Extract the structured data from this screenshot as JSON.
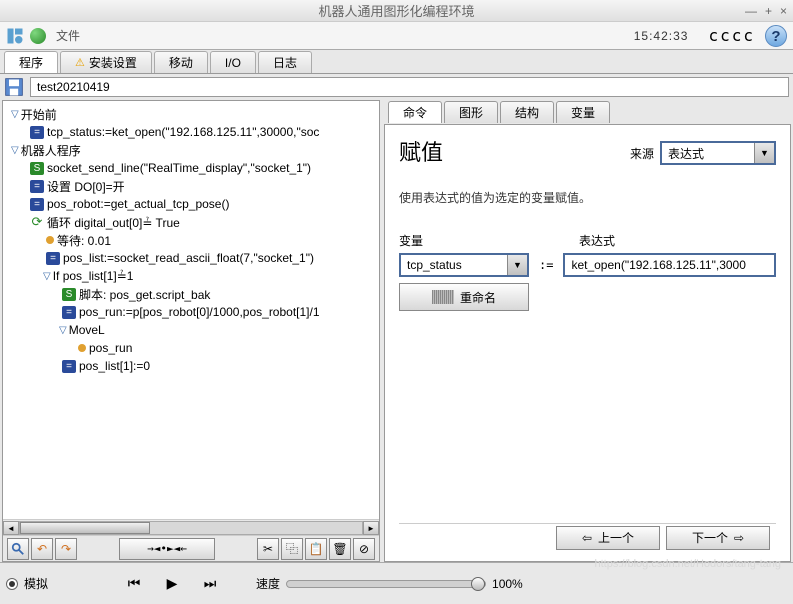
{
  "title": "机器人通用图形化编程环境",
  "win_btns": {
    "min": "—",
    "max": "+",
    "close": "×"
  },
  "menu": {
    "file": "文件"
  },
  "clock": "15:42:33",
  "cccc": "cccc",
  "help": "?",
  "tabs": [
    {
      "label": "程序",
      "active": true,
      "warn": false
    },
    {
      "label": "安装设置",
      "active": false,
      "warn": true
    },
    {
      "label": "移动",
      "active": false,
      "warn": false
    },
    {
      "label": "I/O",
      "active": false,
      "warn": false
    },
    {
      "label": "日志",
      "active": false,
      "warn": false
    }
  ],
  "filename": "test20210419",
  "tree": [
    {
      "indent": 0,
      "ico": "tri",
      "text": "开始前"
    },
    {
      "indent": 1,
      "ico": "blue",
      "text": "tcp_status:=ket_open(\"192.168.125.11\",30000,\"soc"
    },
    {
      "indent": 0,
      "ico": "tri",
      "text": "机器人程序"
    },
    {
      "indent": 1,
      "ico": "green",
      "text": "socket_send_line(\"RealTime_display\",\"socket_1\")"
    },
    {
      "indent": 1,
      "ico": "blue",
      "text": "设置 DO[0]=开"
    },
    {
      "indent": 1,
      "ico": "blue",
      "text": "pos_robot:=get_actual_tcp_pose()"
    },
    {
      "indent": 1,
      "ico": "cycle",
      "text": "循环 digital_out[0]≟ True"
    },
    {
      "indent": 2,
      "ico": "dot",
      "text": "等待: 0.01"
    },
    {
      "indent": 2,
      "ico": "blue",
      "text": "pos_list:=socket_read_ascii_float(7,\"socket_1\")"
    },
    {
      "indent": 2,
      "ico": "tri",
      "text": "If pos_list[1]≟1"
    },
    {
      "indent": 3,
      "ico": "green",
      "text": "脚本: pos_get.script_bak"
    },
    {
      "indent": 3,
      "ico": "blue",
      "text": "pos_run:=p[pos_robot[0]/1000,pos_robot[1]/1"
    },
    {
      "indent": 3,
      "ico": "tri",
      "text": "MoveL"
    },
    {
      "indent": 4,
      "ico": "dot",
      "text": "pos_run"
    },
    {
      "indent": 3,
      "ico": "blue",
      "text": "pos_list[1]:=0"
    }
  ],
  "edit_toolbar": {
    "move": "→◄•►◄←"
  },
  "right_tabs": [
    {
      "label": "命令",
      "active": true
    },
    {
      "label": "图形",
      "active": false
    },
    {
      "label": "结构",
      "active": false
    },
    {
      "label": "变量",
      "active": false
    }
  ],
  "right": {
    "heading": "赋值",
    "desc": "使用表达式的值为选定的变量赋值。",
    "source_label": "来源",
    "source_value": "表达式",
    "var_label": "变量",
    "expr_label": "表达式",
    "var_value": "tcp_status",
    "assign_op": ":=",
    "expr_value": "ket_open(\"192.168.125.11\",3000",
    "rename": "重命名"
  },
  "nav": {
    "prev": "上一个",
    "next": "下一个"
  },
  "playback": {
    "sim": "模拟",
    "speed_label": "速度",
    "speed_value": "100%"
  },
  "watermark": "https://blog.csdn.net/Hodors/tang-tang"
}
